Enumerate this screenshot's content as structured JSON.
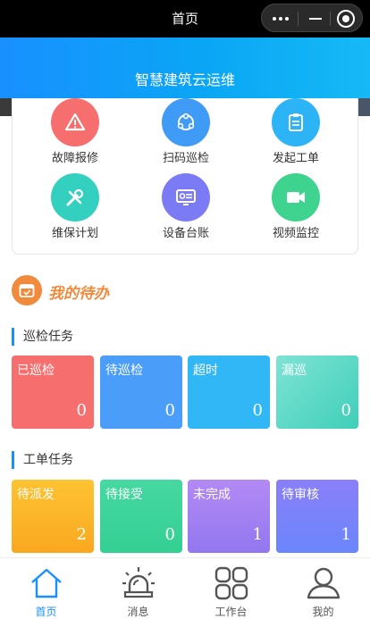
{
  "nav": {
    "title": "首页"
  },
  "header": {
    "title": "智慧建筑云运维"
  },
  "functions": [
    {
      "label": "故障报修",
      "icon": "warning-icon",
      "color": "#f66e6e"
    },
    {
      "label": "扫码巡检",
      "icon": "scan-icon",
      "color": "#3f9bf6"
    },
    {
      "label": "发起工单",
      "icon": "clipboard-icon",
      "color": "#2cb4f7"
    },
    {
      "label": "维保计划",
      "icon": "tools-icon",
      "color": "#33d0c0"
    },
    {
      "label": "设备台账",
      "icon": "device-icon",
      "color": "#7b7cf5"
    },
    {
      "label": "视频监控",
      "icon": "video-camera-icon",
      "color": "#3ed48f"
    }
  ],
  "todo": {
    "title": "我的待办"
  },
  "inspection": {
    "title": "巡检任务",
    "tiles": [
      {
        "label": "已巡检",
        "value": "0",
        "color": "#f66e6e"
      },
      {
        "label": "待巡检",
        "value": "0",
        "color": "#4a9df8"
      },
      {
        "label": "超时",
        "value": "0",
        "color": "#31b6f6"
      },
      {
        "label": "漏巡",
        "value": "0",
        "color": "#4fd8c4"
      }
    ]
  },
  "workorder": {
    "title": "工单任务",
    "tiles": [
      {
        "label": "待派发",
        "value": "2",
        "color": "#fcb71f"
      },
      {
        "label": "待接受",
        "value": "0",
        "color": "#3ed49a"
      },
      {
        "label": "未完成",
        "value": "1",
        "color": "#9f7ef3"
      },
      {
        "label": "待审核",
        "value": "1",
        "color": "#6f82fb"
      }
    ]
  },
  "tabbar": [
    {
      "label": "首页",
      "icon": "home-icon",
      "active": true
    },
    {
      "label": "消息",
      "icon": "alarm-icon",
      "active": false
    },
    {
      "label": "工作台",
      "icon": "grid-icon",
      "active": false
    },
    {
      "label": "我的",
      "icon": "user-icon",
      "active": false
    }
  ]
}
